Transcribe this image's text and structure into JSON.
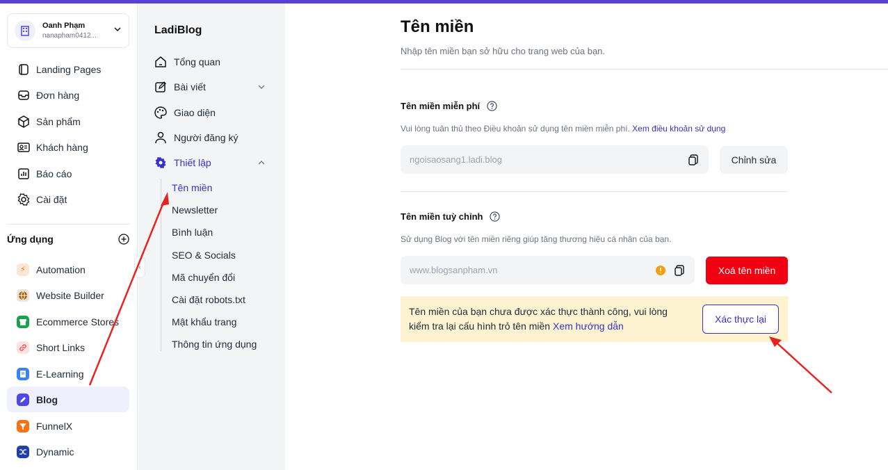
{
  "account": {
    "name": "Oanh Phạm",
    "email": "nanapham0412..."
  },
  "sidebar": {
    "nav": [
      {
        "label": "Landing Pages",
        "icon": "layers-icon"
      },
      {
        "label": "Đơn hàng",
        "icon": "inbox-icon"
      },
      {
        "label": "Sản phẩm",
        "icon": "box-icon"
      },
      {
        "label": "Khách hàng",
        "icon": "id-card-icon"
      },
      {
        "label": "Báo cáo",
        "icon": "chart-icon"
      },
      {
        "label": "Cài đặt",
        "icon": "gear-icon"
      }
    ],
    "apps_title": "Ứng dụng",
    "apps": [
      {
        "label": "Automation",
        "icon": "bolt-icon",
        "color": "#fde7d4"
      },
      {
        "label": "Website Builder",
        "icon": "globe-icon",
        "color": "#f1e1d6"
      },
      {
        "label": "Ecommerce Stores",
        "icon": "store-icon",
        "color": "#16a34a"
      },
      {
        "label": "Short Links",
        "icon": "link-icon",
        "color": "#fde2e2"
      },
      {
        "label": "E-Learning",
        "icon": "book-icon",
        "color": "#3b82f6"
      },
      {
        "label": "Blog",
        "icon": "edit-icon",
        "color": "#4f46e5"
      },
      {
        "label": "FunnelX",
        "icon": "funnel-icon",
        "color": "#f97316"
      },
      {
        "label": "Dynamic",
        "icon": "shuffle-icon",
        "color": "#1e40af"
      }
    ]
  },
  "subnav": {
    "title": "LadiBlog",
    "items": [
      {
        "label": "Tổng quan"
      },
      {
        "label": "Bài viết"
      },
      {
        "label": "Giao diện"
      },
      {
        "label": "Người đăng ký"
      },
      {
        "label": "Thiết lập"
      }
    ],
    "settings_items": [
      "Tên miền",
      "Newsletter",
      "Bình luận",
      "SEO & Socials",
      "Mã chuyển đổi",
      "Cài đặt robots.txt",
      "Mật khẩu trang",
      "Thông tin ứng dụng"
    ]
  },
  "page": {
    "title": "Tên miền",
    "description": "Nhập tên miền bạn sở hữu cho trang web của bạn.",
    "free": {
      "title": "Tên miền miễn phí",
      "desc": "Vui lòng tuân thủ theo Điều khoản sử dụng tên miền miễn phí.",
      "link": "Xem điều khoản sử dụng",
      "value": "ngoisaosang1.ladi.blog",
      "edit_button": "Chỉnh sửa"
    },
    "custom": {
      "title": "Tên miền tuỳ chỉnh",
      "desc": "Sử dụng Blog với tên miền riêng giúp tăng thương hiệu cá nhân của bạn.",
      "value": "www.blogsanpham.vn",
      "delete_button": "Xoá tên miền"
    },
    "warning": {
      "text": "Tên miền của bạn chưa được xác thực thành công, vui lòng kiểm tra lại cấu hình trỏ tên miền",
      "link": "Xem hướng dẫn",
      "button": "Xác thực lại"
    }
  },
  "colors": {
    "accent": "#3730c9",
    "danger": "#f10012",
    "annotation": "#e8231f",
    "warning_bg": "#fdf3d1"
  }
}
